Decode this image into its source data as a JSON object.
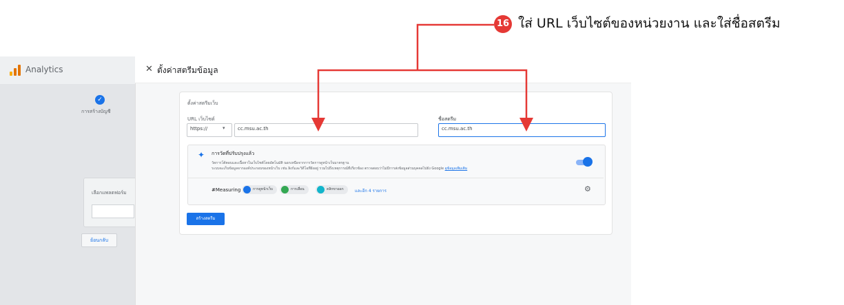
{
  "annotation": {
    "step_number": "16",
    "instruction": "ใส่ URL เว็บไซต์ของหน่วยงาน และใส่ชื่อสตรีม",
    "arrow_color": "#e53935"
  },
  "app": {
    "title": "Analytics",
    "stepper_label": "การสร้างบัญชี",
    "platform_label": "เลือกแพลตฟอร์ม",
    "back_button": "ย้อนกลับ"
  },
  "panel": {
    "title": "ตั้งค่าสตรีมข้อมูล",
    "section_title": "ตั้งค่าสตรีมเว็บ",
    "url_label": "URL เว็บไซต์",
    "protocol_value": "https://",
    "url_value": "cc.msu.ac.th",
    "stream_name_label": "ชื่อสตรีม",
    "stream_name_value": "cc.msu.ac.th",
    "enhanced": {
      "title": "การวัดที่ปรับปรุงแล้ว",
      "desc1": "วัดการโต้ตอบและเนื้อหาในเว็บไซต์โดยอัตโนมัติ นอกเหนือจากการวัดการดูหน้าเว็บมาตรฐาน",
      "desc2": "ระบบจะเก็บข้อมูลจากองค์ประกอบของหน้าเว็บ เช่น ลิงก์และวิดีโอที่ฝังอยู่ รวมไปถึงเหตุการณ์ที่เกี่ยวข้อง ตรวจสอบว่าไม่มีการส่งข้อมูลส่วนบุคคลไปยัง Google",
      "learn_more": "ดูข้อมูลเพิ่มเติม",
      "measuring_label": "#Measuring",
      "chips": [
        "การดูหน้าเว็บ",
        "การเลื่อน",
        "คลิกขาออก"
      ],
      "more_link": "และอีก 4 รายการ",
      "toggle_on": true
    },
    "create_button": "สร้างสตรีม"
  },
  "colors": {
    "accent": "#1a73e8",
    "annotation_red": "#e53935"
  }
}
